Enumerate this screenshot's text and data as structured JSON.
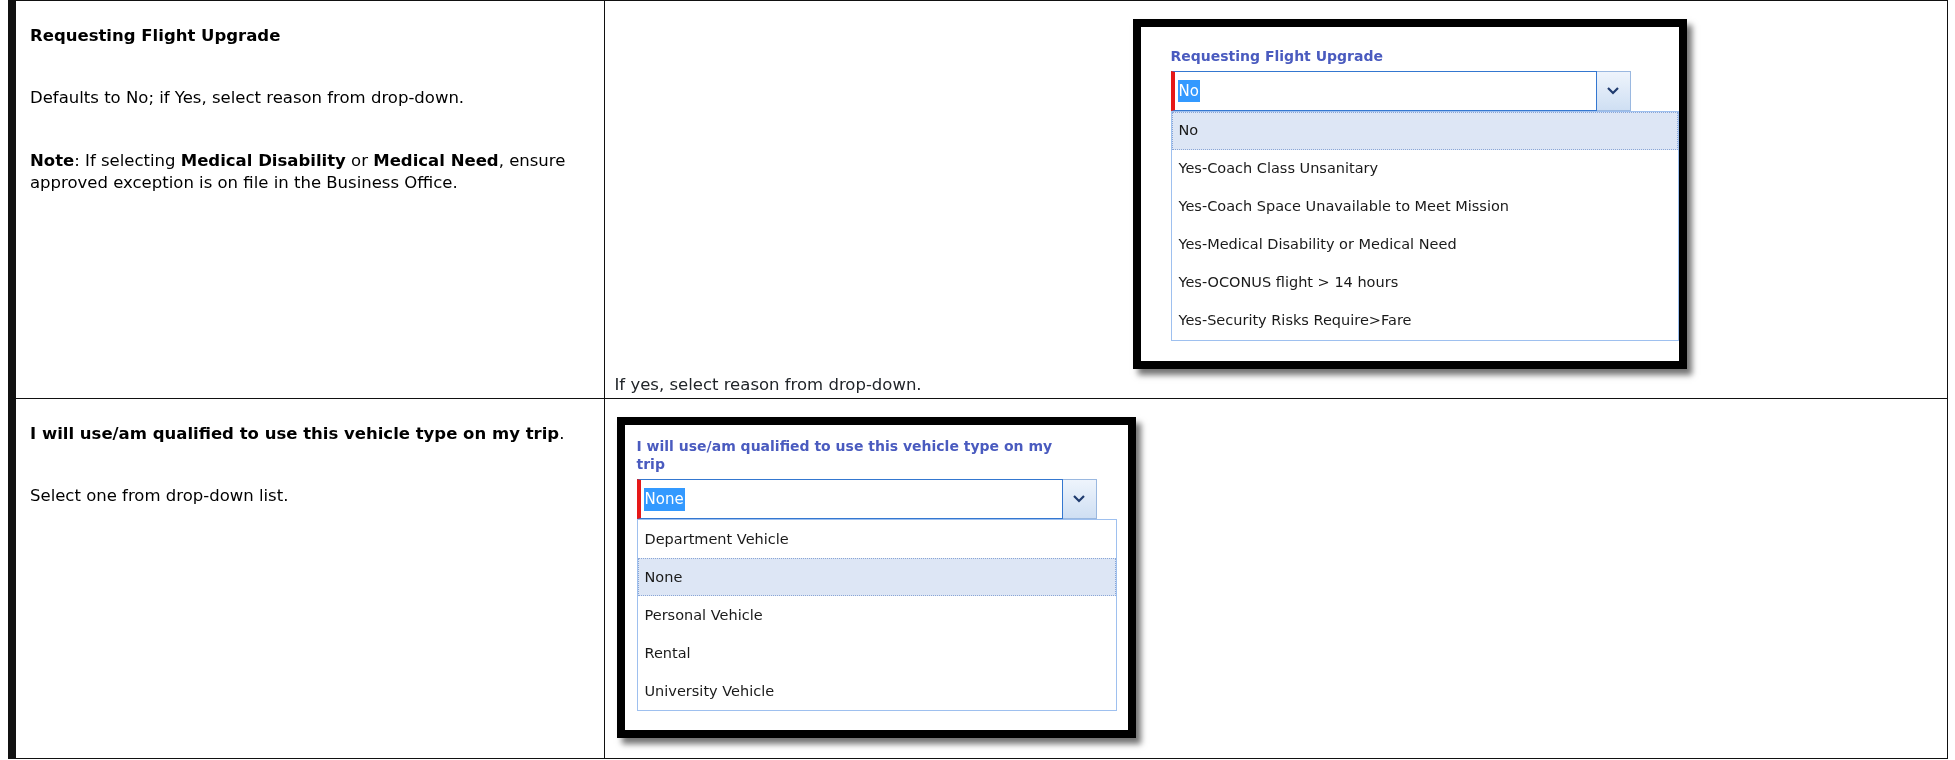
{
  "rows": [
    {
      "heading": "Requesting Flight Upgrade",
      "paragraphs": [
        "Defaults to No; if Yes, select reason from drop-down.",
        "**Note**:  If selecting **Medical Disability** or **Medical Need**, ensure approved exception is on file in the Business Office."
      ],
      "screenshot": {
        "label": "Requesting Flight Upgrade",
        "value": "No",
        "options": [
          {
            "text": "No",
            "selected": true
          },
          {
            "text": "Yes-Coach Class Unsanitary",
            "selected": false
          },
          {
            "text": "Yes-Coach Space Unavailable to Meet Mission",
            "selected": false
          },
          {
            "text": "Yes-Medical Disability or Medical Need",
            "selected": false
          },
          {
            "text": "Yes-OCONUS flight > 14 hours",
            "selected": false
          },
          {
            "text": "Yes-Security Risks Require>Fare",
            "selected": false
          }
        ]
      },
      "caption": "If yes, select reason from drop-down."
    },
    {
      "heading": "I will use/am qualified to use this vehicle type on my trip",
      "heading_tail": ".",
      "paragraphs": [
        "Select one from drop-down list."
      ],
      "screenshot": {
        "label": "I will use/am qualified to use this vehicle type on my trip",
        "value": "None",
        "options": [
          {
            "text": "Department Vehicle",
            "selected": false
          },
          {
            "text": "None",
            "selected": true
          },
          {
            "text": "Personal Vehicle",
            "selected": false
          },
          {
            "text": "Rental",
            "selected": false
          },
          {
            "text": "University Vehicle",
            "selected": false
          }
        ]
      }
    }
  ]
}
